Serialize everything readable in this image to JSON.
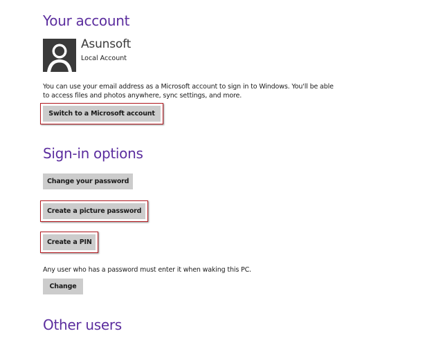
{
  "sections": {
    "account": {
      "title": "Your account",
      "name": "Asunsoft",
      "type": "Local Account",
      "description_line1": "You can use your email address as a Microsoft account to sign in to Windows. You'll be able",
      "description_line2": "to access files and photos anywhere, sync settings, and more.",
      "switch_button": "Switch to a Microsoft account"
    },
    "signin": {
      "title": "Sign-in options",
      "change_password_button": "Change your password",
      "picture_password_button": "Create a picture password",
      "pin_button": "Create a PIN",
      "wake_text": "Any user who has a password must enter it when waking this PC.",
      "change_button": "Change"
    },
    "other": {
      "title": "Other users"
    }
  },
  "colors": {
    "heading": "#5b2d9e",
    "button_bg": "#cccccc",
    "highlight_border": "#b3191f",
    "avatar_bg": "#3a3a3a"
  },
  "icons": {
    "avatar": "user-silhouette-icon"
  }
}
